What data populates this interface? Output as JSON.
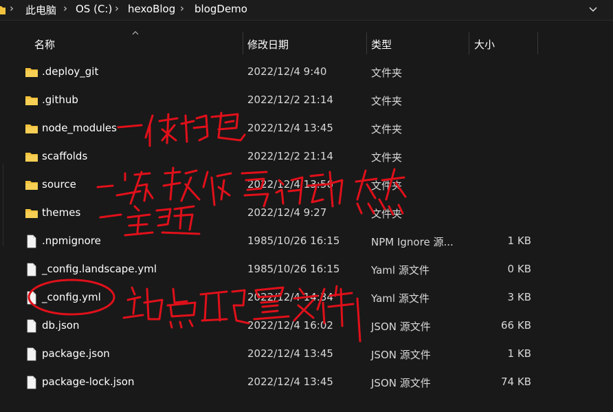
{
  "breadcrumb": {
    "items": [
      "此电脑",
      "OS (C:)",
      "hexoBlog",
      "blogDemo"
    ],
    "separator": "›",
    "dropdown_icon": "chevron-down-icon"
  },
  "columns": {
    "name": "名称",
    "date": "修改日期",
    "type": "类型",
    "size": "大小"
  },
  "files": [
    {
      "name": ".deploy_git",
      "date": "2022/12/4 9:40",
      "type": "文件夹",
      "size": "",
      "icon": "folder-icon"
    },
    {
      "name": ".github",
      "date": "2022/12/2 21:14",
      "type": "文件夹",
      "size": "",
      "icon": "folder-icon"
    },
    {
      "name": "node_modules",
      "date": "2022/12/4 13:45",
      "type": "文件夹",
      "size": "",
      "icon": "folder-icon"
    },
    {
      "name": "scaffolds",
      "date": "2022/12/2 21:14",
      "type": "文件夹",
      "size": "",
      "icon": "folder-icon"
    },
    {
      "name": "source",
      "date": "2022/12/4 13:56",
      "type": "文件夹",
      "size": "",
      "icon": "folder-icon"
    },
    {
      "name": "themes",
      "date": "2022/12/4 9:27",
      "type": "文件夹",
      "size": "",
      "icon": "folder-icon"
    },
    {
      "name": ".npmignore",
      "date": "1985/10/26 16:15",
      "type": "NPM Ignore 源...",
      "size": "1 KB",
      "icon": "file-icon"
    },
    {
      "name": "_config.landscape.yml",
      "date": "1985/10/26 16:15",
      "type": "Yaml 源文件",
      "size": "0 KB",
      "icon": "file-icon"
    },
    {
      "name": "_config.yml",
      "date": "2022/12/4 14:34",
      "type": "Yaml 源文件",
      "size": "3 KB",
      "icon": "file-icon"
    },
    {
      "name": "db.json",
      "date": "2022/12/4 16:02",
      "type": "JSON 源文件",
      "size": "66 KB",
      "icon": "file-icon"
    },
    {
      "name": "package.json",
      "date": "2022/12/4 13:45",
      "type": "JSON 源文件",
      "size": "1 KB",
      "icon": "file-icon"
    },
    {
      "name": "package-lock.json",
      "date": "2022/12/4 13:45",
      "type": "JSON 源文件",
      "size": "74 KB",
      "icon": "file-icon"
    }
  ],
  "annotations": {
    "note_1": "一依赖包",
    "note_2": "二存放你写的动态",
    "note_3": "一主题",
    "note_4": "站点配置文件",
    "ink_color": "#e0101a"
  },
  "colors": {
    "background": "#191919",
    "folder": "#f3c23c",
    "text": "#ffffff"
  }
}
